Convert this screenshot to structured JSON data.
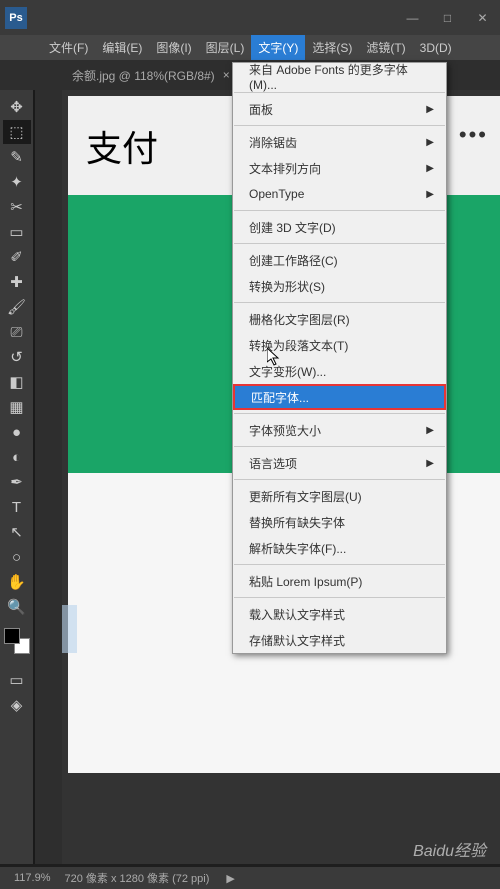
{
  "titlebar": {
    "ps": "Ps"
  },
  "winbtns": {
    "min": "—",
    "max": "□",
    "close": "✕"
  },
  "menu": {
    "file": "文件(F)",
    "edit": "编辑(E)",
    "image": "图像(I)",
    "layer": "图层(L)",
    "type": "文字(Y)",
    "select": "选择(S)",
    "filter": "滤镜(T)",
    "3d": "3D(D)"
  },
  "filetab": {
    "name": "余额.jpg @ 118%(RGB/8#)",
    "close": "×"
  },
  "canvas": {
    "header_text": "支付",
    "dots": "•••"
  },
  "dropdown": {
    "more_fonts": "来自 Adobe Fonts 的更多字体(M)...",
    "panel": "面板",
    "anti_alias": "消除锯齿",
    "orientation": "文本排列方向",
    "opentype": "OpenType",
    "create_3d": "创建 3D 文字(D)",
    "create_path": "创建工作路径(C)",
    "convert_shape": "转换为形状(S)",
    "rasterize": "栅格化文字图层(R)",
    "para": "转换为段落文本(T)",
    "warp": "文字变形(W)...",
    "match_font": "匹配字体...",
    "preview_size": "字体预览大小",
    "lang": "语言选项",
    "update_all": "更新所有文字图层(U)",
    "replace_missing": "替换所有缺失字体",
    "resolve_missing": "解析缺失字体(F)...",
    "paste_lorem": "粘贴 Lorem Ipsum(P)",
    "load_default": "载入默认文字样式",
    "save_default": "存储默认文字样式"
  },
  "status": {
    "zoom": "117.9%",
    "dims": "720 像素 x 1280 像素 (72 ppi)"
  },
  "watermark": "Baidu经验",
  "tools": {
    "move": "✥",
    "marquee": "⬚",
    "lasso": "✎",
    "magic": "✦",
    "crop": "✂",
    "frame": "▭",
    "eyedrop": "✐",
    "heal": "✚",
    "brush": "🖌",
    "stamp": "⎚",
    "history": "↺",
    "eraser": "◧",
    "gradient": "▦",
    "blur": "●",
    "dodge": "◐",
    "pen": "✒",
    "type": "T",
    "path": "↖",
    "shape": "○",
    "hand": "✋",
    "zoom": "🔍"
  },
  "panelicons": {
    "a": "▭",
    "b": "◈",
    "c": "▤"
  }
}
